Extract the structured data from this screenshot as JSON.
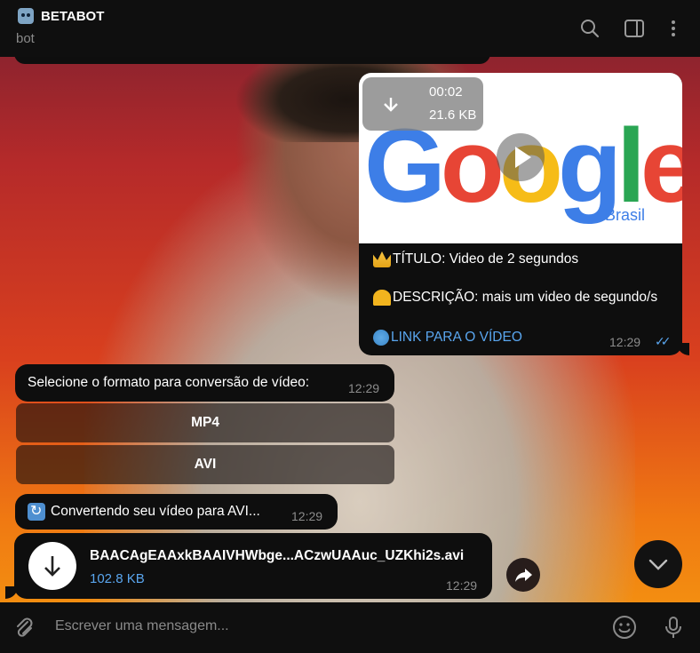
{
  "header": {
    "title": "BETABOT",
    "subtitle": "bot",
    "icons": [
      "search-icon",
      "sidebar-toggle-icon",
      "more-vert-icon"
    ]
  },
  "video_message": {
    "duration": "00:02",
    "size": "21.6 KB",
    "thumbnail_text": "Google",
    "thumbnail_subtext": "Brasil",
    "title_line": "TÍTULO: Video de 2 segundos",
    "description_line": "DESCRIÇÃO: mais um video de segundo/s",
    "link_text": "LINK PARA O VÍDEO",
    "time": "12:29",
    "status": "read"
  },
  "format_prompt": {
    "text": "Selecione o formato para conversão de vídeo:",
    "time": "12:29",
    "buttons": [
      "MP4",
      "AVI"
    ]
  },
  "converting_message": {
    "text": "Convertendo seu vídeo para AVI...",
    "time": "12:29"
  },
  "file_message": {
    "name": "BAACAgEAAxkBAAIVHWbge...ACzwUAAuc_UZKhi2s.avi",
    "size": "102.8 KB",
    "time": "12:29"
  },
  "composer": {
    "placeholder": "Escrever uma mensagem..."
  },
  "colors": {
    "accent": "#5aa6ef",
    "bubble": "#0e0e0e",
    "header": "#0f0f0f"
  }
}
